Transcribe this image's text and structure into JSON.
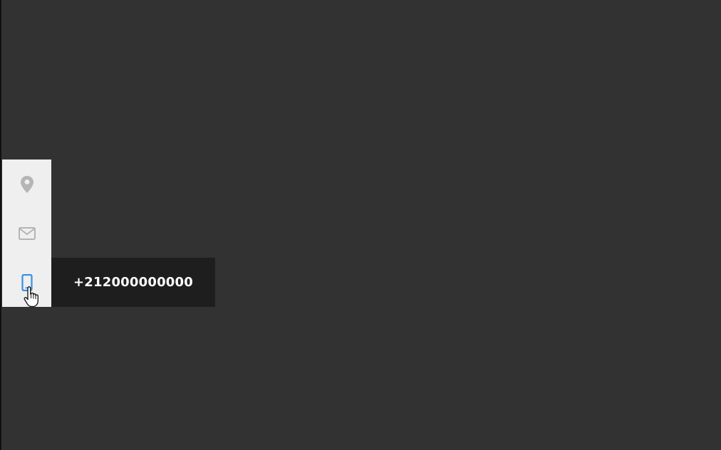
{
  "colors": {
    "background": "#323232",
    "contact_bar": "#efefef",
    "icon_inactive": "#b5b5b5",
    "icon_active": "#3a8fde",
    "tooltip_bg": "#1e1e1e",
    "tooltip_text": "#ffffff"
  },
  "contact_bar": {
    "items": [
      {
        "icon": "location-pin-icon",
        "active": false
      },
      {
        "icon": "envelope-icon",
        "active": false
      },
      {
        "icon": "mobile-phone-icon",
        "active": true
      }
    ]
  },
  "tooltip": {
    "phone_number": "+212000000000"
  },
  "cursor": {
    "icon": "hand-pointer-icon"
  }
}
